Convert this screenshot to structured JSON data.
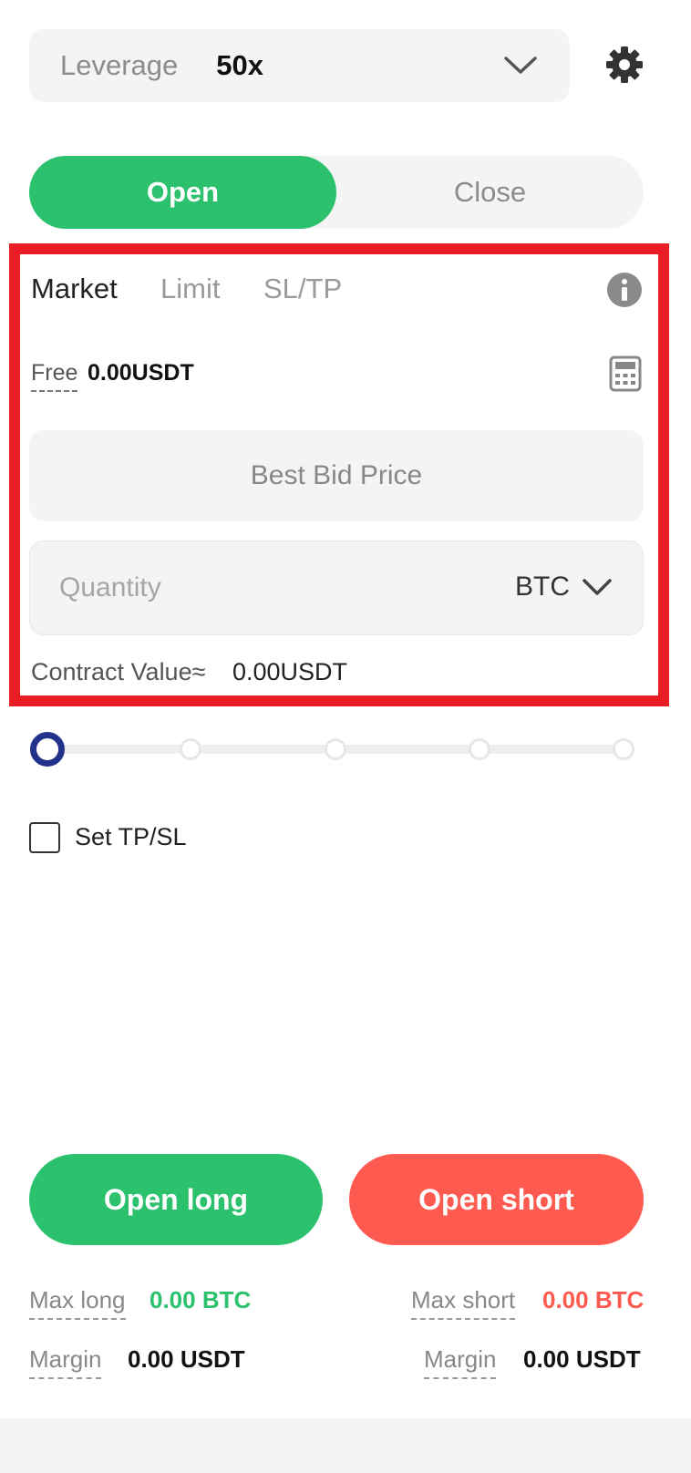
{
  "leverage": {
    "label": "Leverage",
    "value": "50x"
  },
  "mode_toggle": {
    "open_label": "Open",
    "close_label": "Close",
    "active": "Open"
  },
  "order_tabs": {
    "market": "Market",
    "limit": "Limit",
    "sltp": "SL/TP",
    "active": "Market"
  },
  "balance": {
    "label": "Free",
    "value": "0.00USDT"
  },
  "price_field": {
    "text": "Best Bid Price"
  },
  "quantity_field": {
    "placeholder": "Quantity",
    "unit": "BTC"
  },
  "contract_value": {
    "label": "Contract Value≈",
    "value": "0.00USDT"
  },
  "slider": {
    "value_percent": 0,
    "stops": 5
  },
  "tpsl": {
    "label": "Set TP/SL",
    "checked": false
  },
  "actions": {
    "open_long": "Open long",
    "open_short": "Open short"
  },
  "stats": {
    "max_long_label": "Max long",
    "max_long_value": "0.00 BTC",
    "max_short_label": "Max short",
    "max_short_value": "0.00 BTC",
    "margin_long_label": "Margin",
    "margin_long_value": "0.00 USDT",
    "margin_short_label": "Margin",
    "margin_short_value": "0.00 USDT"
  },
  "colors": {
    "buy_green": "#2bc16d",
    "sell_red": "#ff5a50",
    "highlight_red": "#ea1c24",
    "slider_navy": "#23328a"
  }
}
